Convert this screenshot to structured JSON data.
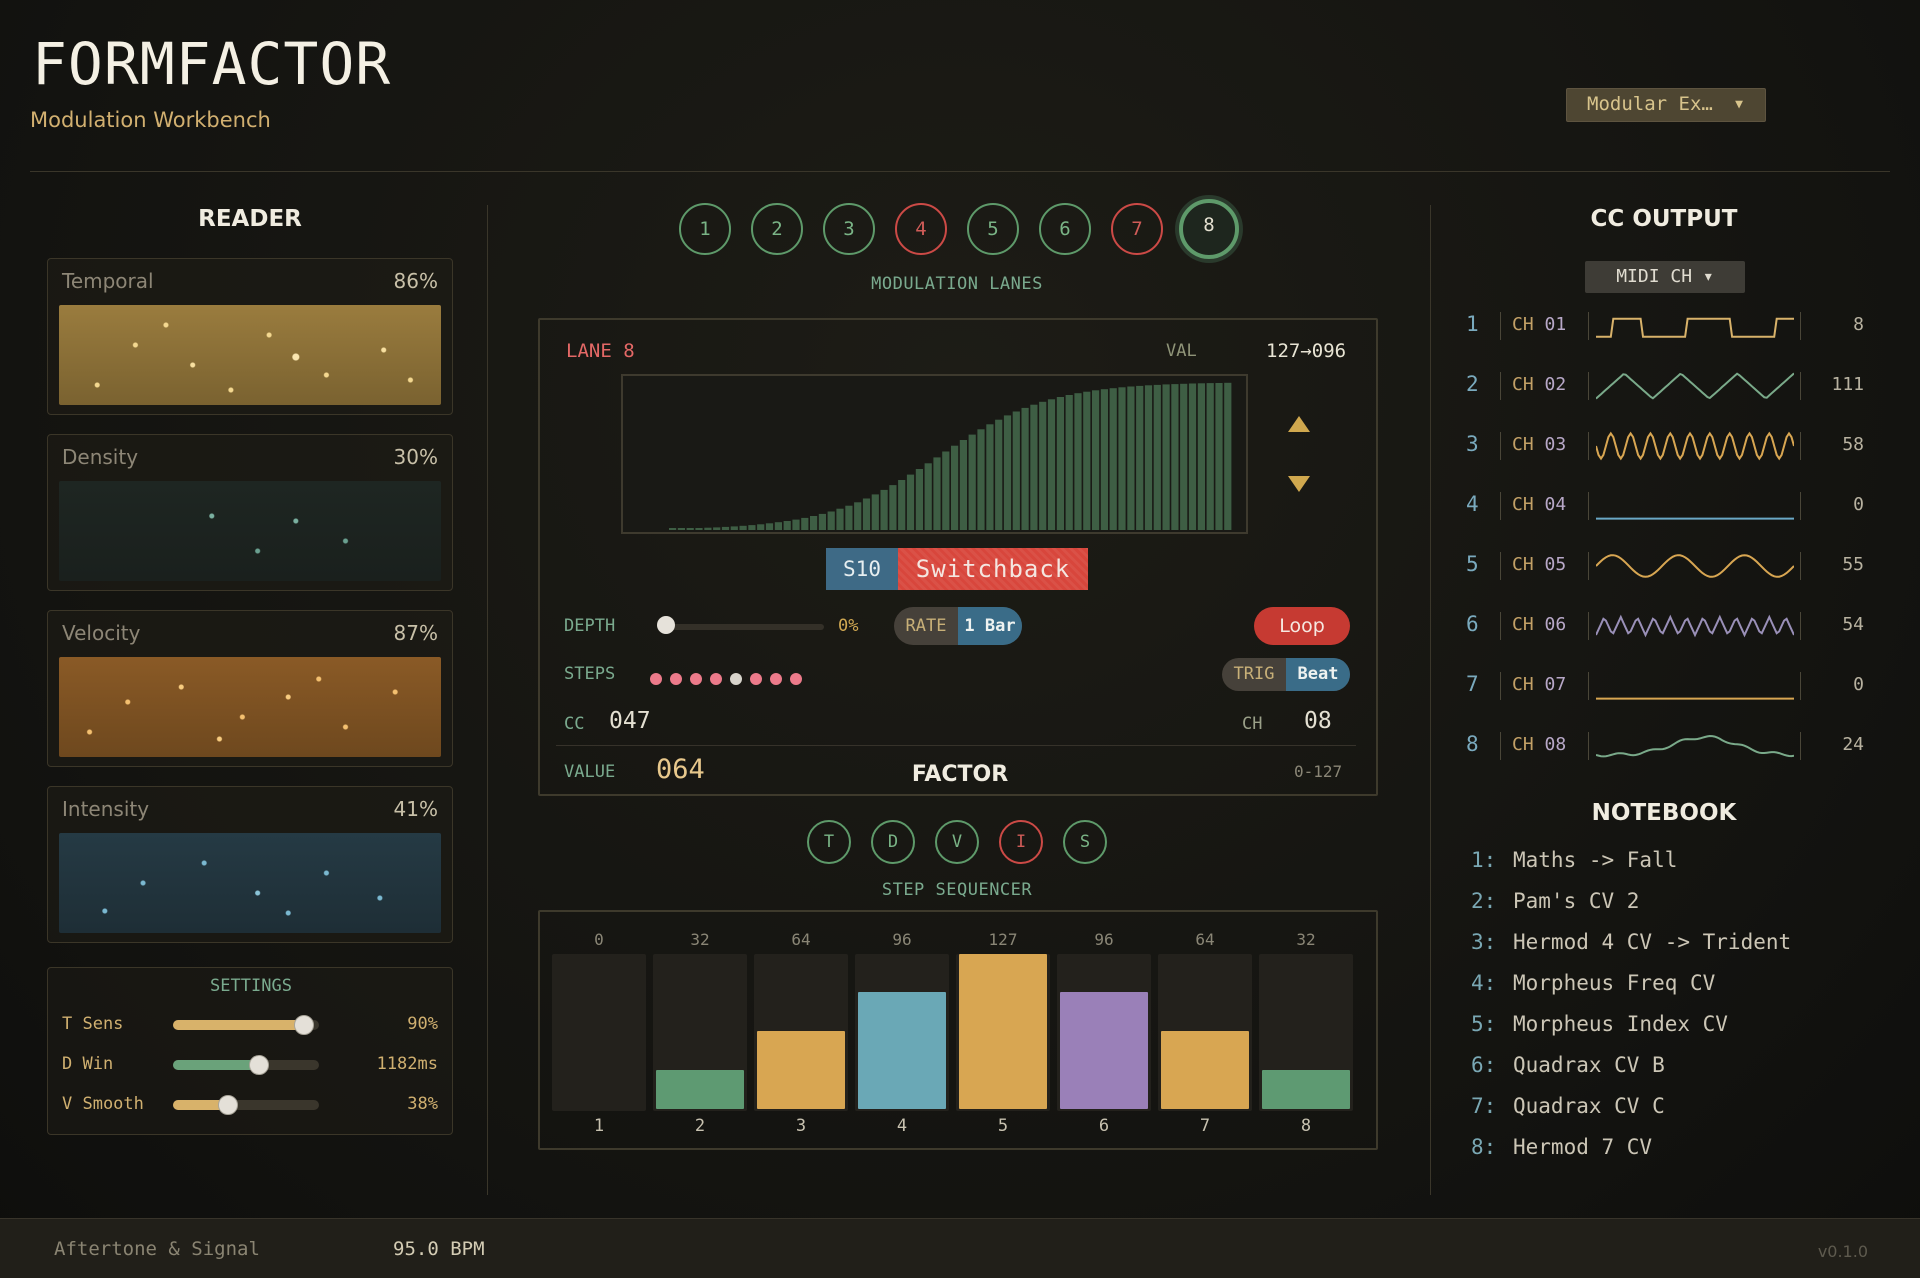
{
  "header": {
    "title": "FORMFACTOR",
    "subtitle": "Modulation Workbench",
    "preset": "Modular Ex…"
  },
  "reader": {
    "heading": "READER",
    "cards": [
      {
        "label": "Temporal",
        "value": "86%"
      },
      {
        "label": "Density",
        "value": "30%"
      },
      {
        "label": "Velocity",
        "value": "87%"
      },
      {
        "label": "Intensity",
        "value": "41%"
      }
    ]
  },
  "settings": {
    "heading": "SETTINGS",
    "items": [
      {
        "label": "T Sens",
        "value": "90%",
        "level": 0.9,
        "color": "#d8b26a"
      },
      {
        "label": "D Win",
        "value": "1182ms",
        "level": 0.59,
        "color": "#6aa27a"
      },
      {
        "label": "V Smooth",
        "value": "38%",
        "level": 0.38,
        "color": "#d8b26a"
      }
    ]
  },
  "lanes": {
    "caption": "MODULATION LANES",
    "buttons": [
      "1",
      "2",
      "3",
      "4",
      "5",
      "6",
      "7",
      "8"
    ],
    "active": "8"
  },
  "editor": {
    "lane_label": "LANE 8",
    "val_label": "VAL",
    "val_range": "127→096",
    "shape_tag": "S10",
    "shape_name": "Switchback",
    "depth_label": "DEPTH",
    "depth_value": "0%",
    "rate_label": "RATE",
    "rate_value": "1 Bar",
    "loop_label": "Loop",
    "steps_label": "STEPS",
    "trig_label": "TRIG",
    "trig_value": "Beat",
    "cc_label": "CC",
    "cc_value": "047",
    "ch_label": "CH",
    "ch_value": "08",
    "value_label": "VALUE",
    "value": "064",
    "range_label": "0-127"
  },
  "factor": {
    "heading": "FACTOR",
    "buttons": [
      "T",
      "D",
      "V",
      "I",
      "S"
    ],
    "caption": "STEP SEQUENCER"
  },
  "sequencer": {
    "steps": [
      {
        "num": "1",
        "value": 0,
        "color": "#2a2822"
      },
      {
        "num": "2",
        "value": 32,
        "color": "#5e9a72"
      },
      {
        "num": "3",
        "value": 64,
        "color": "#d8a652"
      },
      {
        "num": "4",
        "value": 96,
        "color": "#6aa8b6"
      },
      {
        "num": "5",
        "value": 127,
        "color": "#d8a652"
      },
      {
        "num": "6",
        "value": 96,
        "color": "#9a80b8"
      },
      {
        "num": "7",
        "value": 64,
        "color": "#d8a652"
      },
      {
        "num": "8",
        "value": 32,
        "color": "#5e9a72"
      }
    ]
  },
  "cc_output": {
    "heading": "CC OUTPUT",
    "midi_select": "MIDI CH ▾",
    "rows": [
      {
        "idx": "1",
        "ch_prefix": "CH",
        "ch": "01",
        "value": "8",
        "wave": "square",
        "color": "#d8b26a"
      },
      {
        "idx": "2",
        "ch_prefix": "CH",
        "ch": "02",
        "value": "111",
        "wave": "triangle",
        "color": "#7aaa8a"
      },
      {
        "idx": "3",
        "ch_prefix": "CH",
        "ch": "03",
        "value": "58",
        "wave": "fast",
        "color": "#d8a652"
      },
      {
        "idx": "4",
        "ch_prefix": "CH",
        "ch": "04",
        "value": "0",
        "wave": "flat",
        "color": "#6aa8c6"
      },
      {
        "idx": "5",
        "ch_prefix": "CH",
        "ch": "05",
        "value": "55",
        "wave": "sine",
        "color": "#d8a652"
      },
      {
        "idx": "6",
        "ch_prefix": "CH",
        "ch": "06",
        "value": "54",
        "wave": "zigzag",
        "color": "#9a90b8"
      },
      {
        "idx": "7",
        "ch_prefix": "CH",
        "ch": "07",
        "value": "0",
        "wave": "flat",
        "color": "#d8a652"
      },
      {
        "idx": "8",
        "ch_prefix": "CH",
        "ch": "08",
        "value": "24",
        "wave": "bump",
        "color": "#7aaa8a"
      }
    ]
  },
  "notebook": {
    "heading": "NOTEBOOK",
    "items": [
      {
        "idx": "1:",
        "text": "Maths -> Fall"
      },
      {
        "idx": "2:",
        "text": "Pam's CV 2"
      },
      {
        "idx": "3:",
        "text": "Hermod 4 CV -> Trident"
      },
      {
        "idx": "4:",
        "text": "Morpheus Freq CV"
      },
      {
        "idx": "5:",
        "text": "Morpheus Index CV"
      },
      {
        "idx": "6:",
        "text": "Quadrax CV B"
      },
      {
        "idx": "7:",
        "text": "Quadrax CV C"
      },
      {
        "idx": "8:",
        "text": "Hermod 7 CV"
      }
    ]
  },
  "footer": {
    "left": "Aftertone & Signal",
    "bpm": "95.0 BPM",
    "version": "v0.1.0"
  },
  "colors": {
    "accent_green": "#5e9a6a",
    "accent_red": "#cc4a46",
    "accent_gold": "#d8b26a"
  }
}
